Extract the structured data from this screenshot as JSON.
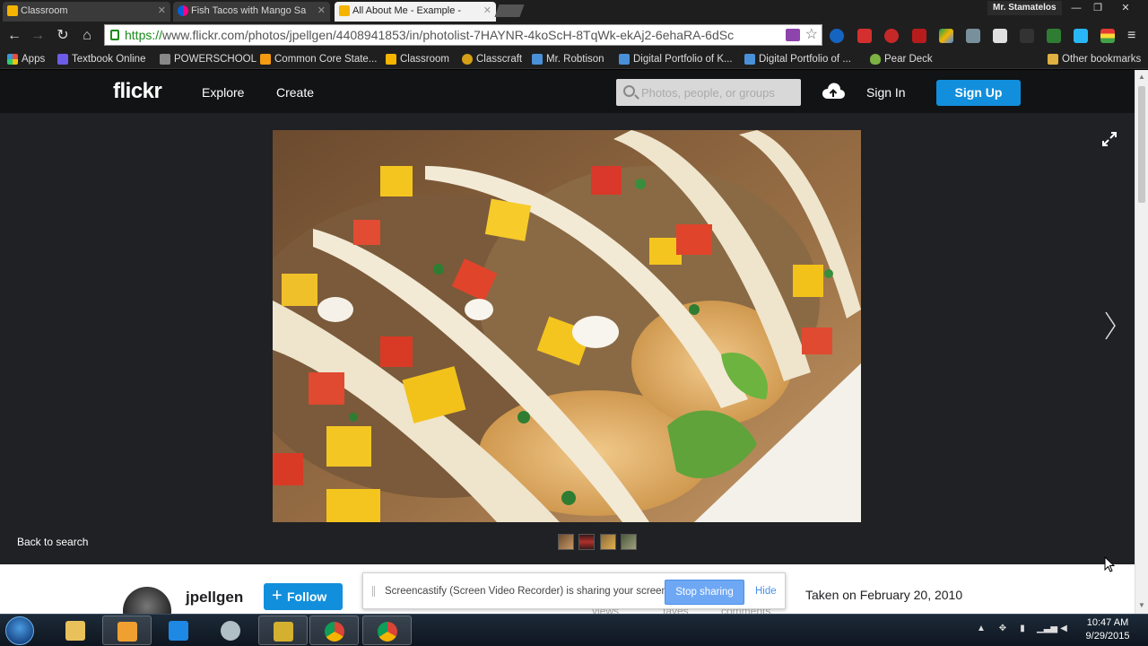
{
  "browser": {
    "tabs": [
      {
        "title": "Classroom",
        "favicon_color": "#f4b400",
        "active": false
      },
      {
        "title": "Fish Tacos with Mango Sa",
        "favicon_color": "#ff0084",
        "active": true
      },
      {
        "title": "All About Me - Example -",
        "favicon_color": "#f4b400",
        "active": false
      }
    ],
    "user": "Mr. Stamatelos",
    "window_controls": {
      "minimize": "—",
      "restore": "❐",
      "close": "✕"
    },
    "url_scheme": "https://",
    "url_rest": "www.flickr.com/photos/jpellgen/4408941853/in/photolist-7HAYNR-4koScH-8TqWk-ekAj2-6ehaRA-6dSc",
    "bookmarks": [
      {
        "label": "Apps",
        "color": "#e74c3c"
      },
      {
        "label": "Textbook Online",
        "color": "#6c5ce7"
      },
      {
        "label": "POWERSCHOOL",
        "color": "#888888"
      },
      {
        "label": "Common Core State...",
        "color": "#f39c12"
      },
      {
        "label": "Classroom",
        "color": "#f4b400"
      },
      {
        "label": "Classcraft",
        "color": "#d4a017"
      },
      {
        "label": "Mr. Robtison",
        "color": "#4a90d9"
      },
      {
        "label": "Digital Portfolio of K...",
        "color": "#4a90d9"
      },
      {
        "label": "Digital Portfolio of ...",
        "color": "#4a90d9"
      },
      {
        "label": "Pear Deck",
        "color": "#7cb342"
      }
    ],
    "other_bookmarks": "Other bookmarks"
  },
  "flickr": {
    "logo": "flickr",
    "nav": {
      "explore": "Explore",
      "create": "Create"
    },
    "search_placeholder": "Photos, people, or groups",
    "sign_in": "Sign In",
    "sign_up": "Sign Up",
    "back_to_search": "Back to search",
    "owner": {
      "username": "jpellgen",
      "follow_label": "Follow"
    },
    "stats": {
      "views": "views",
      "faves": "faves",
      "comments": "comments"
    },
    "taken": "Taken on February 20, 2010"
  },
  "screencastify": {
    "message": "Screencastify (Screen Video Recorder) is sharing your screen.",
    "stop": "Stop sharing",
    "hide": "Hide"
  },
  "taskbar": {
    "time": "10:47 AM",
    "date": "9/29/2015"
  },
  "colors": {
    "flickr_blue": "#128fdc",
    "flickr_header": "#121314",
    "stage": "#202124"
  }
}
